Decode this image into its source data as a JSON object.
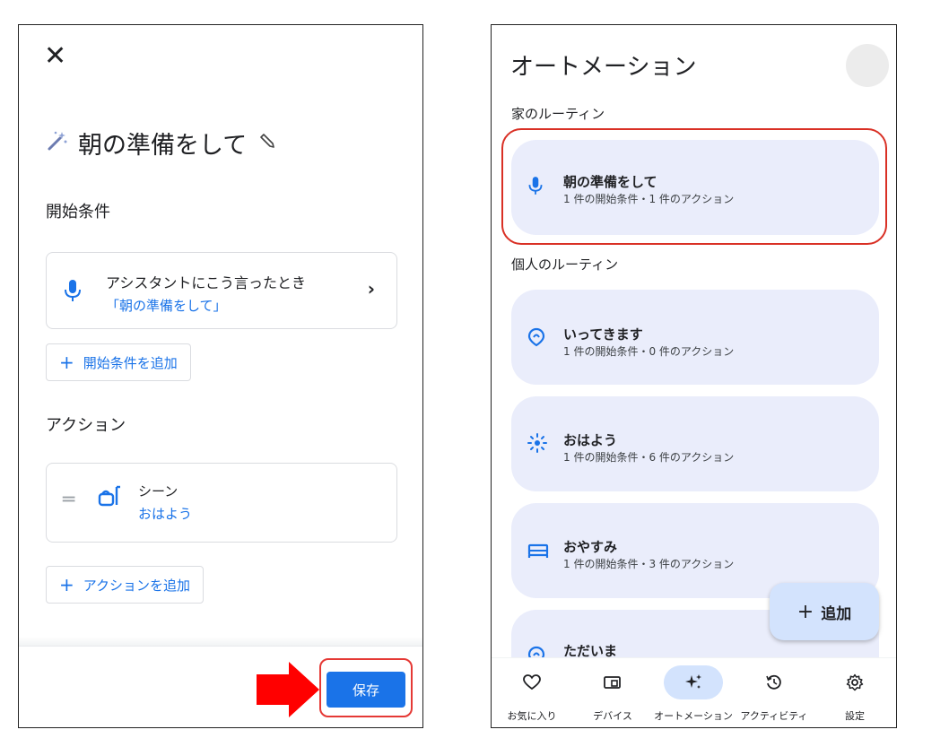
{
  "left": {
    "close_glyph": "✕",
    "title": "朝の準備をして",
    "starters_heading": "開始条件",
    "starter": {
      "label": "アシスタントにこう言ったとき",
      "value": "「朝の準備をして」"
    },
    "add_starter_label": "開始条件を追加",
    "actions_heading": "アクション",
    "action": {
      "label": "シーン",
      "value": "おはよう"
    },
    "add_action_label": "アクションを追加",
    "save_label": "保存"
  },
  "right": {
    "title": "オートメーション",
    "home_section": "家のルーティン",
    "personal_section": "個人のルーティン",
    "home_routines": [
      {
        "name": "朝の準備をして",
        "summary": "1 件の開始条件・1 件のアクション",
        "icon": "mic-icon"
      }
    ],
    "personal_routines": [
      {
        "name": "いってきます",
        "summary": "1 件の開始条件・0 件のアクション",
        "icon": "location-icon"
      },
      {
        "name": "おはよう",
        "summary": "1 件の開始条件・6 件のアクション",
        "icon": "sunrise-icon"
      },
      {
        "name": "おやすみ",
        "summary": "1 件の開始条件・3 件のアクション",
        "icon": "bed-icon"
      },
      {
        "name": "ただいま",
        "summary": "",
        "icon": "location-icon"
      }
    ],
    "fab_label": "追加",
    "nav": [
      {
        "label": "お気に入り",
        "icon": "heart-icon",
        "active": false
      },
      {
        "label": "デバイス",
        "icon": "devices-icon",
        "active": false
      },
      {
        "label": "オートメーション",
        "icon": "sparkle-icon",
        "active": true
      },
      {
        "label": "アクティビティ",
        "icon": "history-icon",
        "active": false
      },
      {
        "label": "設定",
        "icon": "gear-icon",
        "active": false
      }
    ]
  },
  "colors": {
    "accent": "#1a73e8",
    "highlight_red": "#e53935",
    "routine_bg": "#eaedfb",
    "fab_bg": "#d3e3fd"
  }
}
